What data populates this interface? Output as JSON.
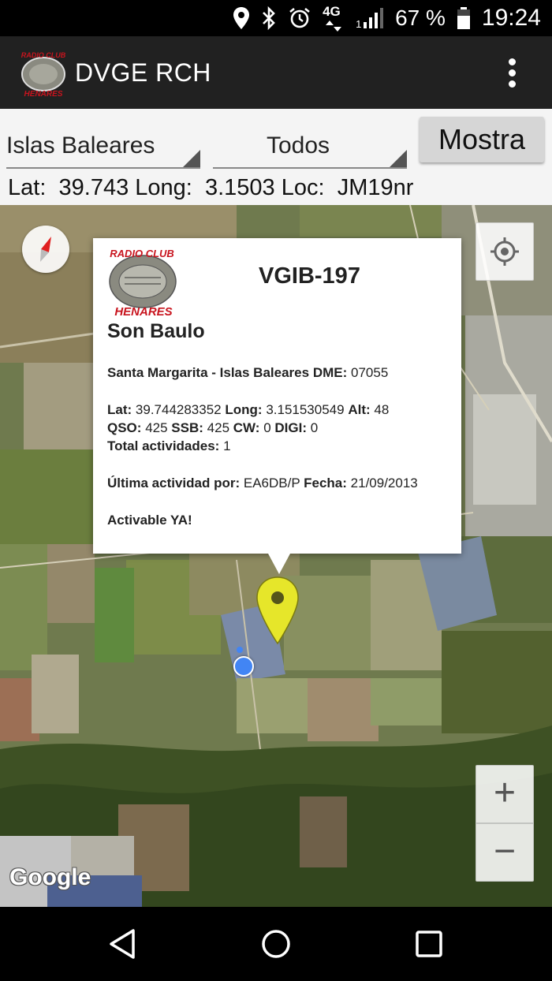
{
  "status_bar": {
    "network": "4G",
    "sim": "1",
    "battery_pct": "67 %",
    "time": "19:24",
    "icons": [
      "location-pin-icon",
      "bluetooth-icon",
      "alarm-icon",
      "signal-icon",
      "battery-icon"
    ]
  },
  "app_bar": {
    "title": "DVGE RCH",
    "logo_text": "RADIO CLUB HENARES",
    "menu_icon": "overflow-menu-icon"
  },
  "filters": {
    "region": "Islas Baleares",
    "type": "Todos",
    "show_button": "Mostra"
  },
  "position": {
    "lat_label": "Lat:",
    "lat": "39.743",
    "long_label": "Long:",
    "long": "3.1503",
    "loc_label": "Loc:",
    "loc": "JM19nr"
  },
  "info_window": {
    "code": "VGIB-197",
    "name": "Son Baulo",
    "location": "Santa Margarita - Islas Baleares",
    "dme_label": "DME:",
    "dme": "07055",
    "lat_label": "Lat:",
    "lat": "39.744283352",
    "long_label": "Long:",
    "long": "3.151530549",
    "alt_label": "Alt:",
    "alt": "48",
    "qso_label": "QSO:",
    "qso": "425",
    "ssb_label": "SSB:",
    "ssb": "425",
    "cw_label": "CW:",
    "cw": "0",
    "digi_label": "DIGI:",
    "digi": "0",
    "total_label": "Total actividades:",
    "total": "1",
    "last_label": "Última actividad por:",
    "last_by": "EA6DB/P",
    "date_label": "Fecha:",
    "date": "21/09/2013",
    "status": "Activable YA!"
  },
  "map": {
    "attribution": "Google",
    "zoom_in": "+",
    "zoom_out": "−",
    "marker_color": "#e6e62a",
    "location_dot_color": "#4285f4"
  },
  "nav_bar": {
    "back_icon": "back-icon",
    "home_icon": "home-icon",
    "recents_icon": "recents-icon"
  }
}
